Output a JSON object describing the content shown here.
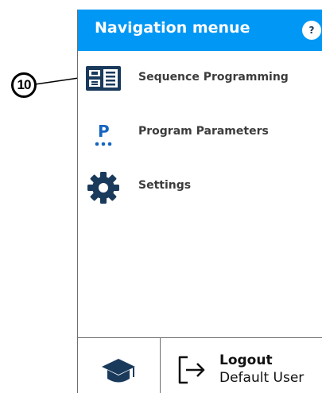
{
  "callout": {
    "number": "10"
  },
  "header": {
    "title": "Navigation menue",
    "help_label": "?"
  },
  "menu": {
    "items": [
      {
        "label": "Sequence Programming",
        "icon": "sequence-list-icon"
      },
      {
        "label": "Program Parameters",
        "icon": "parameter-p-icon"
      },
      {
        "label": "Settings",
        "icon": "gear-icon"
      }
    ]
  },
  "footer": {
    "training_icon": "graduation-cap-icon",
    "logout_label": "Logout",
    "user_name": "Default User",
    "logout_icon": "logout-arrow-icon"
  },
  "colors": {
    "header_bg": "#0097f5",
    "icon_dark": "#1a3a5c",
    "icon_accent": "#1565c0",
    "label_text": "#3c3c3c"
  }
}
